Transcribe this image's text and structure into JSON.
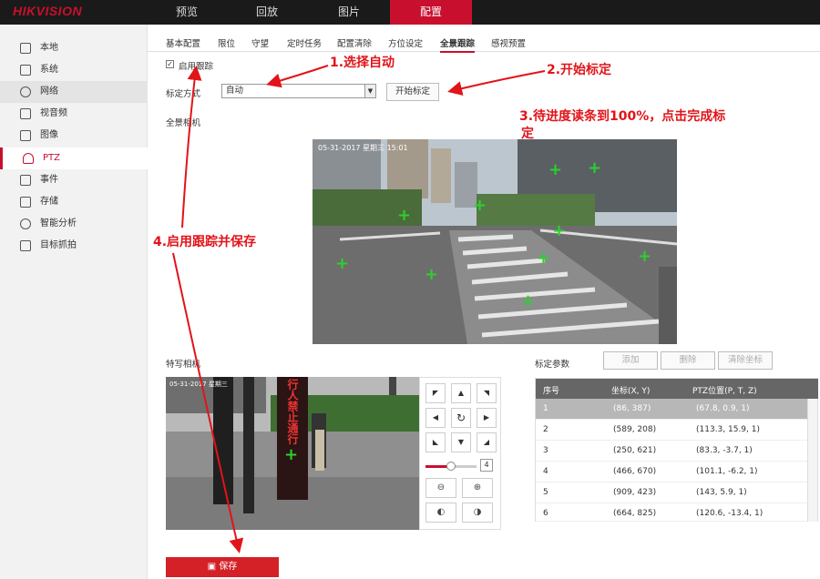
{
  "header": {
    "logo": "HIKVISION",
    "nav": [
      "预览",
      "回放",
      "图片",
      "配置"
    ],
    "active_nav": "配置"
  },
  "sidebar": {
    "items": [
      "本地",
      "系统",
      "网络",
      "视音频",
      "图像",
      "PTZ",
      "事件",
      "存储",
      "智能分析",
      "目标抓拍"
    ],
    "active": "PTZ"
  },
  "tabs": [
    "基本配置",
    "限位",
    "守望",
    "定时任务",
    "配置清除",
    "方位设定",
    "全景跟踪",
    "感视预置"
  ],
  "active_tab": "全景跟踪",
  "form": {
    "enable_tracking_label": "启用跟踪",
    "enable_tracking_checked": true,
    "calibration_mode_label": "标定方式",
    "calibration_mode_value": "自动",
    "start_calibration_button": "开始标定",
    "panorama_label": "全景相机",
    "detail_label": "特写相机",
    "calib_params_label": "标定参数"
  },
  "panorama_overlay": {
    "date_text": "05-31-2017 星期三 15:01"
  },
  "detail_overlay": {
    "date_text": "05-31-2017 星期三",
    "sign_text": "行人禁止通行"
  },
  "ptz": {
    "speed_value": "4",
    "speed_fraction": 0.5,
    "direction_icons": [
      "up-left-arrow-icon",
      "up-arrow-icon",
      "up-right-arrow-icon",
      "left-arrow-icon",
      "auto-rotate-icon",
      "right-arrow-icon",
      "down-left-arrow-icon",
      "down-arrow-icon",
      "down-right-arrow-icon"
    ]
  },
  "table": {
    "buttons": [
      "添加",
      "删除",
      "清除坐标"
    ],
    "headers": [
      "序号",
      "坐标(X, Y)",
      "PTZ位置(P, T, Z)"
    ],
    "rows": [
      [
        "1",
        "(86, 387)",
        "(67.8, 0.9, 1)"
      ],
      [
        "2",
        "(589, 208)",
        "(113.3, 15.9, 1)"
      ],
      [
        "3",
        "(250, 621)",
        "(83.3, -3.7, 1)"
      ],
      [
        "4",
        "(466, 670)",
        "(101.1, -6.2, 1)"
      ],
      [
        "5",
        "(909, 423)",
        "(143, 5.9, 1)"
      ],
      [
        "6",
        "(664, 825)",
        "(120.6, -13.4, 1)"
      ]
    ],
    "selected_row": 0
  },
  "save_button": "保存",
  "annotations": [
    "1.选择自动",
    "2.开始标定",
    "3.待进度读条到100%，点击完成标",
    "定",
    "4.启用跟踪并保存"
  ],
  "colors": {
    "accent": "#c8102e",
    "annotation": "#e1141a",
    "marker": "#2bd12b"
  }
}
